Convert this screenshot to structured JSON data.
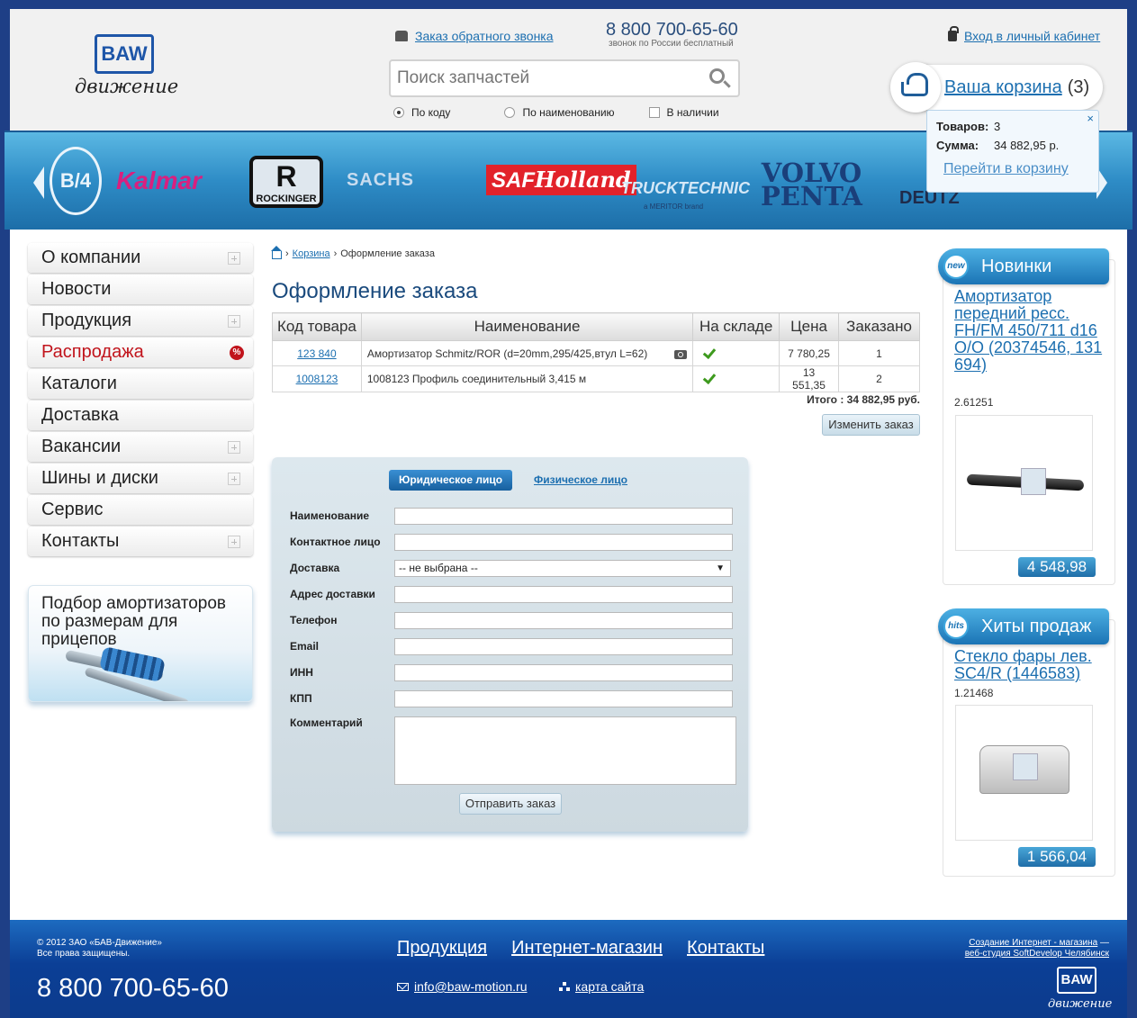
{
  "header": {
    "logo_text": "BAW",
    "logo_script": "движение",
    "callback_link": "Заказ обратного звонка",
    "phone": "8 800 700-65-60",
    "phone_note": "звонок по России бесплатный",
    "search": {
      "placeholder": "Поиск запчастей"
    },
    "search_modes": [
      "По коду",
      "По наименованию"
    ],
    "in_stock_label": "В наличии",
    "login_link": "Вход в личный кабинет",
    "cart": {
      "label": "Ваша корзина",
      "count": "(3)"
    }
  },
  "cart_popup": {
    "items_label": "Товаров:",
    "items_value": "3",
    "sum_label": "Сумма:",
    "sum_value": "34 882,95 р.",
    "go_link": "Перейти в корзину",
    "close": "×"
  },
  "brands": [
    "B/4",
    "Kalmar",
    "ROCKINGER",
    "SACHS",
    "SAF",
    "Holland",
    "TRUCKTECHNIC",
    "a MERITOR brand",
    "VOLVO",
    "PENTA",
    "DEUTZ"
  ],
  "menu": [
    {
      "label": "О компании"
    },
    {
      "label": "Новости"
    },
    {
      "label": "Продукция"
    },
    {
      "label": "Распродажа",
      "badge": "%"
    },
    {
      "label": "Каталоги"
    },
    {
      "label": "Доставка"
    },
    {
      "label": "Вакансии"
    },
    {
      "label": "Шины и диски"
    },
    {
      "label": "Сервис"
    },
    {
      "label": "Контакты"
    }
  ],
  "promo_text": "Подбор амортизаторов по размерам для прицепов",
  "breadcrumb": {
    "cart": "Корзина",
    "current": "Оформление заказа",
    "sep": "›"
  },
  "page_title": "Оформление заказа",
  "order_table": {
    "headers": [
      "Код товара",
      "Наименование",
      "На складе",
      "Цена",
      "Заказано"
    ],
    "rows": [
      {
        "code": "123 840",
        "name": "Амортизатор Schmitz/ROR (d=20mm,295/425,втул L=62)",
        "price": "7 780,25",
        "qty": "1"
      },
      {
        "code": "1008123",
        "name": "1008123 Профиль соединительный 3,415 м",
        "price": "13 551,35",
        "qty": "2"
      }
    ],
    "total": "Итого : 34 882,95 руб.",
    "change_button": "Изменить заказ"
  },
  "form": {
    "tab_legal": "Юридическое лицо",
    "tab_person": "Физическое лицо",
    "fields": {
      "name": "Наименование",
      "contact": "Контактное лицо",
      "delivery": "Доставка",
      "address": "Адрес доставки",
      "phone": "Телефон",
      "email": "Email",
      "inn": "ИНН",
      "kpp": "КПП",
      "comment": "Комментарий"
    },
    "delivery_value": "-- не выбрана --",
    "submit": "Отправить заказ"
  },
  "novelties": {
    "title": "Новинки",
    "badge": "new",
    "link": "Амортизатор передний ресс. FH/FM 450/711 d16 O/O (20374546, 131 694)",
    "code": "2.61251",
    "price": "4 548,98"
  },
  "hits": {
    "title": "Хиты продаж",
    "badge": "hits",
    "link": "Стекло фары лев. SC4/R (1446583)",
    "code": "1.21468",
    "price": "1 566,04"
  },
  "footer": {
    "copyright_1": "© 2012 ЗАО «БАВ-Движение»",
    "copyright_2": "Все права защищены.",
    "phone": "8 800 700-65-60",
    "nav": [
      "Продукция",
      "Интернет-магазин",
      "Контакты"
    ],
    "email": "info@baw-motion.ru",
    "sitemap": "карта сайта",
    "credit_1": "Создание Интернет - магазина",
    "credit_2": "веб-студия SoftDevelop Челябинск",
    "logo_text": "BAW",
    "logo_script": "движение"
  },
  "colors": {
    "brand_blue": "#1e3f86",
    "link": "#1c6fb0",
    "sale_red": "#c1141c",
    "accent": "#1b74b5"
  }
}
